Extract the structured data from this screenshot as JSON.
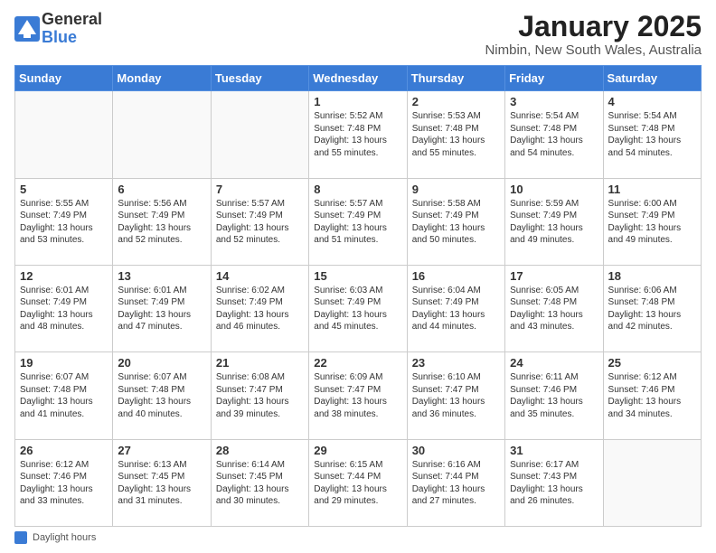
{
  "logo": {
    "general": "General",
    "blue": "Blue"
  },
  "header": {
    "month": "January 2025",
    "location": "Nimbin, New South Wales, Australia"
  },
  "days_of_week": [
    "Sunday",
    "Monday",
    "Tuesday",
    "Wednesday",
    "Thursday",
    "Friday",
    "Saturday"
  ],
  "weeks": [
    [
      {
        "day": null,
        "info": null
      },
      {
        "day": null,
        "info": null
      },
      {
        "day": null,
        "info": null
      },
      {
        "day": "1",
        "info": "Sunrise: 5:52 AM\nSunset: 7:48 PM\nDaylight: 13 hours\nand 55 minutes."
      },
      {
        "day": "2",
        "info": "Sunrise: 5:53 AM\nSunset: 7:48 PM\nDaylight: 13 hours\nand 55 minutes."
      },
      {
        "day": "3",
        "info": "Sunrise: 5:54 AM\nSunset: 7:48 PM\nDaylight: 13 hours\nand 54 minutes."
      },
      {
        "day": "4",
        "info": "Sunrise: 5:54 AM\nSunset: 7:48 PM\nDaylight: 13 hours\nand 54 minutes."
      }
    ],
    [
      {
        "day": "5",
        "info": "Sunrise: 5:55 AM\nSunset: 7:49 PM\nDaylight: 13 hours\nand 53 minutes."
      },
      {
        "day": "6",
        "info": "Sunrise: 5:56 AM\nSunset: 7:49 PM\nDaylight: 13 hours\nand 52 minutes."
      },
      {
        "day": "7",
        "info": "Sunrise: 5:57 AM\nSunset: 7:49 PM\nDaylight: 13 hours\nand 52 minutes."
      },
      {
        "day": "8",
        "info": "Sunrise: 5:57 AM\nSunset: 7:49 PM\nDaylight: 13 hours\nand 51 minutes."
      },
      {
        "day": "9",
        "info": "Sunrise: 5:58 AM\nSunset: 7:49 PM\nDaylight: 13 hours\nand 50 minutes."
      },
      {
        "day": "10",
        "info": "Sunrise: 5:59 AM\nSunset: 7:49 PM\nDaylight: 13 hours\nand 49 minutes."
      },
      {
        "day": "11",
        "info": "Sunrise: 6:00 AM\nSunset: 7:49 PM\nDaylight: 13 hours\nand 49 minutes."
      }
    ],
    [
      {
        "day": "12",
        "info": "Sunrise: 6:01 AM\nSunset: 7:49 PM\nDaylight: 13 hours\nand 48 minutes."
      },
      {
        "day": "13",
        "info": "Sunrise: 6:01 AM\nSunset: 7:49 PM\nDaylight: 13 hours\nand 47 minutes."
      },
      {
        "day": "14",
        "info": "Sunrise: 6:02 AM\nSunset: 7:49 PM\nDaylight: 13 hours\nand 46 minutes."
      },
      {
        "day": "15",
        "info": "Sunrise: 6:03 AM\nSunset: 7:49 PM\nDaylight: 13 hours\nand 45 minutes."
      },
      {
        "day": "16",
        "info": "Sunrise: 6:04 AM\nSunset: 7:49 PM\nDaylight: 13 hours\nand 44 minutes."
      },
      {
        "day": "17",
        "info": "Sunrise: 6:05 AM\nSunset: 7:48 PM\nDaylight: 13 hours\nand 43 minutes."
      },
      {
        "day": "18",
        "info": "Sunrise: 6:06 AM\nSunset: 7:48 PM\nDaylight: 13 hours\nand 42 minutes."
      }
    ],
    [
      {
        "day": "19",
        "info": "Sunrise: 6:07 AM\nSunset: 7:48 PM\nDaylight: 13 hours\nand 41 minutes."
      },
      {
        "day": "20",
        "info": "Sunrise: 6:07 AM\nSunset: 7:48 PM\nDaylight: 13 hours\nand 40 minutes."
      },
      {
        "day": "21",
        "info": "Sunrise: 6:08 AM\nSunset: 7:47 PM\nDaylight: 13 hours\nand 39 minutes."
      },
      {
        "day": "22",
        "info": "Sunrise: 6:09 AM\nSunset: 7:47 PM\nDaylight: 13 hours\nand 38 minutes."
      },
      {
        "day": "23",
        "info": "Sunrise: 6:10 AM\nSunset: 7:47 PM\nDaylight: 13 hours\nand 36 minutes."
      },
      {
        "day": "24",
        "info": "Sunrise: 6:11 AM\nSunset: 7:46 PM\nDaylight: 13 hours\nand 35 minutes."
      },
      {
        "day": "25",
        "info": "Sunrise: 6:12 AM\nSunset: 7:46 PM\nDaylight: 13 hours\nand 34 minutes."
      }
    ],
    [
      {
        "day": "26",
        "info": "Sunrise: 6:12 AM\nSunset: 7:46 PM\nDaylight: 13 hours\nand 33 minutes."
      },
      {
        "day": "27",
        "info": "Sunrise: 6:13 AM\nSunset: 7:45 PM\nDaylight: 13 hours\nand 31 minutes."
      },
      {
        "day": "28",
        "info": "Sunrise: 6:14 AM\nSunset: 7:45 PM\nDaylight: 13 hours\nand 30 minutes."
      },
      {
        "day": "29",
        "info": "Sunrise: 6:15 AM\nSunset: 7:44 PM\nDaylight: 13 hours\nand 29 minutes."
      },
      {
        "day": "30",
        "info": "Sunrise: 6:16 AM\nSunset: 7:44 PM\nDaylight: 13 hours\nand 27 minutes."
      },
      {
        "day": "31",
        "info": "Sunrise: 6:17 AM\nSunset: 7:43 PM\nDaylight: 13 hours\nand 26 minutes."
      },
      {
        "day": null,
        "info": null
      }
    ]
  ],
  "footer": {
    "label": "Daylight hours"
  }
}
